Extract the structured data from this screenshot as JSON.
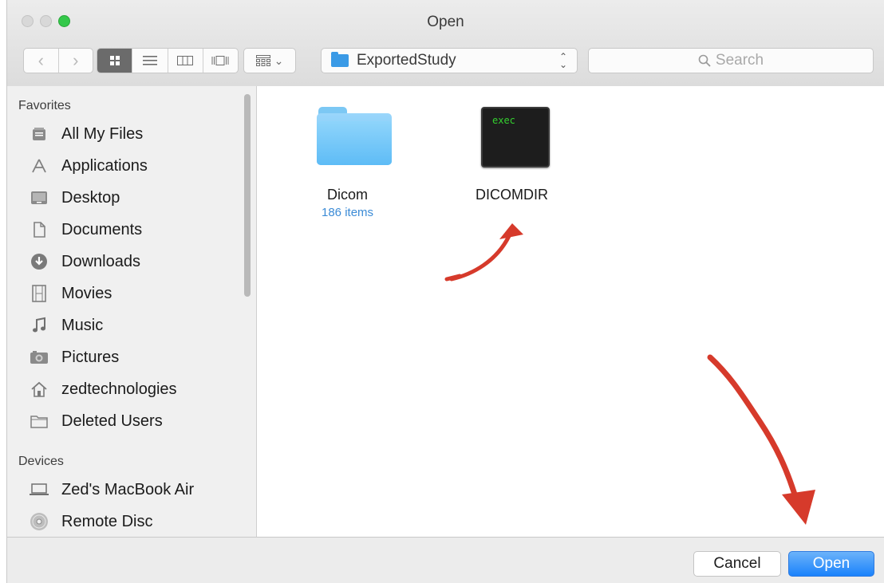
{
  "window": {
    "title": "Open"
  },
  "toolbar": {
    "path_label": "ExportedStudy",
    "search_placeholder": "Search"
  },
  "sidebar": {
    "favorites_header": "Favorites",
    "favorites": [
      {
        "label": "All My Files",
        "icon": "all-files-icon"
      },
      {
        "label": "Applications",
        "icon": "applications-icon"
      },
      {
        "label": "Desktop",
        "icon": "desktop-icon"
      },
      {
        "label": "Documents",
        "icon": "documents-icon"
      },
      {
        "label": "Downloads",
        "icon": "downloads-icon"
      },
      {
        "label": "Movies",
        "icon": "movies-icon"
      },
      {
        "label": "Music",
        "icon": "music-icon"
      },
      {
        "label": "Pictures",
        "icon": "pictures-icon"
      },
      {
        "label": "zedtechnologies",
        "icon": "home-icon"
      },
      {
        "label": "Deleted Users",
        "icon": "folder-icon"
      }
    ],
    "devices_header": "Devices",
    "devices": [
      {
        "label": "Zed's MacBook Air",
        "icon": "laptop-icon"
      },
      {
        "label": "Remote Disc",
        "icon": "disc-icon"
      }
    ]
  },
  "files": [
    {
      "name": "Dicom",
      "subtitle": "186 items",
      "kind": "folder"
    },
    {
      "name": "DICOMDIR",
      "kind": "exec",
      "icon_text": "exec"
    }
  ],
  "buttons": {
    "cancel": "Cancel",
    "open": "Open"
  },
  "colors": {
    "accent": "#1a82fb",
    "folder": "#69c2f7",
    "annotation": "#d63a2b",
    "zoom_light": "#34c84a"
  }
}
